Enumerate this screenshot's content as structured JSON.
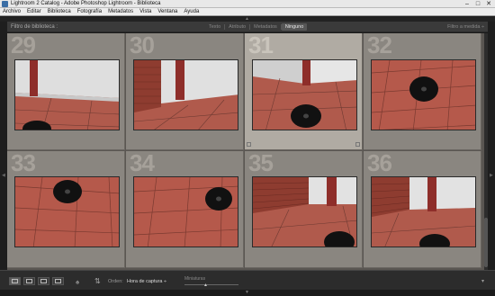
{
  "window": {
    "title": "Lightroom 2 Catalog - Adobe Photoshop Lightroom - Biblioteca",
    "minimize_glyph": "–",
    "maximize_glyph": "□",
    "close_glyph": "✕"
  },
  "menu": [
    "Archivo",
    "Editar",
    "Biblioteca",
    "Fotografía",
    "Metadatos",
    "Vista",
    "Ventana",
    "Ayuda"
  ],
  "filter_bar": {
    "title": "Filtro de biblioteca :",
    "tabs": [
      {
        "label": "Texto",
        "active": false
      },
      {
        "label": "Atributo",
        "active": false
      },
      {
        "label": "Metadatos",
        "active": false
      },
      {
        "label": "Ninguno",
        "active": true
      }
    ],
    "preset": "Filtro a medida ÷"
  },
  "grid": {
    "cells": [
      {
        "number": "29",
        "selected": false,
        "scene": "wall-corner-puck-bottom-left"
      },
      {
        "number": "30",
        "selected": false,
        "scene": "brick-wall-corner"
      },
      {
        "number": "31",
        "selected": true,
        "scene": "wall-corner-puck-center"
      },
      {
        "number": "32",
        "selected": false,
        "scene": "tiles-puck-top"
      },
      {
        "number": "33",
        "selected": false,
        "scene": "tiles-puck-top-left"
      },
      {
        "number": "34",
        "selected": false,
        "scene": "tiles-puck-right"
      },
      {
        "number": "35",
        "selected": false,
        "scene": "brick-wall-corner-puck-bottom"
      },
      {
        "number": "36",
        "selected": false,
        "scene": "brick-wall-corner-puck-bottom"
      }
    ]
  },
  "toolbar": {
    "sort_label": "Orden:",
    "sort_value": "Hora de captura ÷",
    "thumbnails_label": "Miniaturas",
    "view_icons": [
      "grid-view-icon",
      "loupe-view-icon",
      "compare-view-icon",
      "survey-view-icon"
    ],
    "spray_icon": "painter-spray-icon",
    "sort_direction_icon": "sort-direction-icon"
  },
  "colors": {
    "grid_background": "#5a5652",
    "cell": "#8a8680",
    "cell_selected": "#b0aba3",
    "tile": "#b4584a",
    "wall": "#d8d8d8",
    "pipe": "#8a2a2a"
  }
}
